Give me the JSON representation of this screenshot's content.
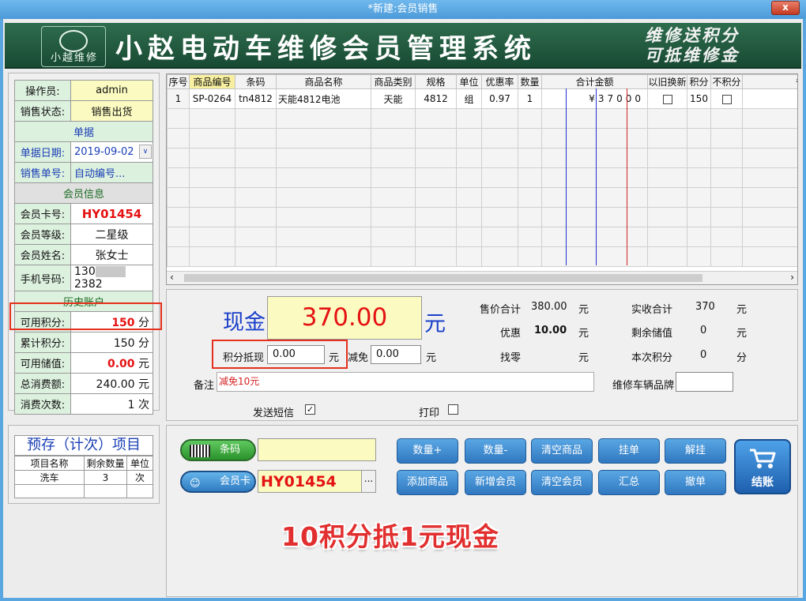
{
  "window": {
    "title": "*新建:会员销售",
    "close_label": "x"
  },
  "banner": {
    "logo_text": "小越维修",
    "system_title": "小赵电动车维修会员管理系统",
    "slogan_line1": "维修送积分",
    "slogan_line2": "可抵维修金"
  },
  "info": {
    "operator_label": "操作员:",
    "operator_value": "admin",
    "sale_status_label": "销售状态:",
    "sale_status_value": "销售出货",
    "doc_section": "单据",
    "doc_date_label": "单据日期:",
    "doc_date_value": "2019-09-02",
    "sale_no_label": "销售单号:",
    "sale_no_value": "自动编号...",
    "member_section": "会员信息",
    "card_label": "会员卡号:",
    "card_value": "HY01454",
    "level_label": "会员等级:",
    "level_value": "二星级",
    "name_label": "会员姓名:",
    "name_value": "张女士",
    "phone_label": "手机号码:",
    "phone_prefix": "130",
    "phone_suffix": "2382",
    "history_section": "历史账户",
    "avail_points_label": "可用积分:",
    "avail_points_value": "150",
    "avail_points_unit": "分",
    "total_points_label": "累计积分:",
    "total_points_value": "150",
    "total_points_unit": "分",
    "avail_stored_label": "可用储值:",
    "avail_stored_value": "0.00",
    "avail_stored_unit": "元",
    "total_spend_label": "总消费额:",
    "total_spend_value": "240.00",
    "total_spend_unit": "元",
    "visit_count_label": "消费次数:",
    "visit_count_value": "1",
    "visit_count_unit": "次"
  },
  "grid": {
    "headers": [
      "序号",
      "商品编号",
      "条码",
      "商品名称",
      "商品类别",
      "规格",
      "单位",
      "优惠率",
      "数量",
      "合计金额",
      "以旧换新",
      "积分",
      "不积分",
      "备注"
    ],
    "row": {
      "no": "1",
      "code": "SP-0264",
      "barcode": "tn4812",
      "name": "天能4812电池",
      "category": "天能",
      "spec": "4812",
      "unit": "组",
      "discount_rate": "0.97",
      "qty": "1",
      "amount": "¥37000",
      "points": "150"
    }
  },
  "totals": {
    "cash_label": "现金",
    "cash_value": "370.00",
    "cash_unit": "元",
    "price_total_label": "售价合计",
    "price_total_value": "380.00",
    "price_total_unit": "元",
    "discount_label": "优惠",
    "discount_value": "10.00",
    "discount_unit": "元",
    "change_label": "找零",
    "change_unit": "元",
    "actual_total_label": "实收合计",
    "actual_total_value": "370",
    "actual_total_unit": "元",
    "remaining_stored_label": "剩余储值",
    "remaining_stored_value": "0",
    "remaining_stored_unit": "元",
    "this_points_label": "本次积分",
    "this_points_value": "0",
    "this_points_unit": "分",
    "points_deduct_label": "积分抵现",
    "points_deduct_value": "0.00",
    "points_deduct_unit": "元",
    "reduce_label": "减免",
    "reduce_value": "0.00",
    "reduce_unit": "元",
    "note_label": "备注",
    "note_value": "减免10元",
    "plate_label": "维修车辆品牌",
    "sms_label": "发送短信",
    "print_label": "打印"
  },
  "preorder": {
    "title": "预存（计次）项目",
    "headers": [
      "项目名称",
      "剩余数量",
      "单位"
    ],
    "rows": [
      {
        "name": "洗车",
        "qty": "3",
        "unit": "次"
      }
    ]
  },
  "actions": {
    "barcode_label": "条码",
    "member_card_label": "会员卡",
    "member_card_value": "HY01454",
    "ellipsis": "...",
    "btn_qty_plus": "数量+",
    "btn_qty_minus": "数量-",
    "btn_clear_goods": "清空商品",
    "btn_hold": "挂单",
    "btn_release": "解挂",
    "btn_add_goods": "添加商品",
    "btn_new_member": "新增会员",
    "btn_clear_member": "清空会员",
    "btn_summary": "汇总",
    "btn_cancel": "撤单",
    "checkout_label": "结账",
    "tip": "10积分抵1元现金"
  },
  "colors": {
    "title_bar": "#4b9ad8",
    "banner": "#1f5a3e",
    "highlight_red": "#e41212",
    "input_yellow": "#fbfbc1",
    "label_green": "#ddf1df",
    "button_blue": "#2f77bf"
  }
}
